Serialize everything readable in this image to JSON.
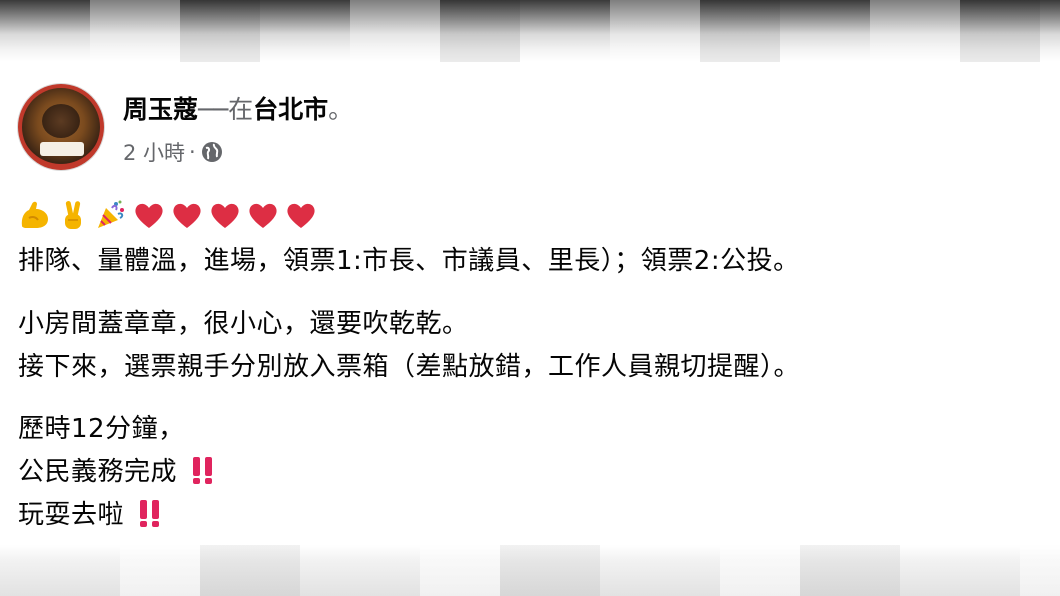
{
  "post": {
    "author": "周玉蔻",
    "location_separator": "──在",
    "location": "台北市",
    "location_suffix": "。",
    "time": "2 小時",
    "time_separator": "·",
    "privacy_icon": "globe-icon",
    "emoji_row": [
      "flexed-biceps-icon",
      "victory-hand-icon",
      "party-popper-icon",
      "red-heart-icon",
      "red-heart-icon",
      "red-heart-icon",
      "red-heart-icon",
      "red-heart-icon"
    ],
    "lines": {
      "l1": "排隊、量體溫，進場，領票1:市長、市議員、里長）；領票2:公投。",
      "l2": "小房間蓋章章，很小心，還要吹乾乾。",
      "l3": "接下來，選票親手分別放入票箱（差點放錯，工作人員親切提醒）。",
      "l4": "歷時12分鐘，",
      "l5": "公民義務完成",
      "l6": "玩耍去啦"
    },
    "accent_red": "#e0245e"
  }
}
